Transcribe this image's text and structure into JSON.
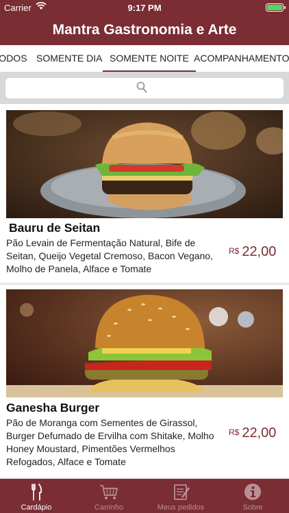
{
  "status_bar": {
    "carrier": "Carrier",
    "time": "9:17 PM"
  },
  "header": {
    "title": "Mantra Gastronomia e Arte"
  },
  "tabs": [
    {
      "label": "TODOS"
    },
    {
      "label": "SOMENTE DIA"
    },
    {
      "label": "SOMENTE NOITE",
      "active": true
    },
    {
      "label": "ACOMPANHAMENTOS"
    }
  ],
  "search": {
    "placeholder": ""
  },
  "menu_items": [
    {
      "name": "Bauru de Seitan",
      "description": "Pão Levain de Fermentação Natural, Bife de Seitan, Queijo Vegetal Cremoso, Bacon Vegano, Molho de Panela, Alface e Tomate",
      "currency": "R$",
      "price": "22,00"
    },
    {
      "name": "Ganesha Burger",
      "description": "Pão de Moranga com Sementes de Girassol, Burger Defumado de Ervilha com Shitake, Molho Honey Moustard, Pimentões Vermelhos Refogados, Alface e Tomate",
      "currency": "R$",
      "price": "22,00"
    }
  ],
  "tab_bar": [
    {
      "label": "Cardápio",
      "icon": "cutlery-icon",
      "active": true
    },
    {
      "label": "Carrinho",
      "icon": "cart-icon"
    },
    {
      "label": "Meus pedidos",
      "icon": "orders-icon"
    },
    {
      "label": "Sobre",
      "icon": "info-icon"
    }
  ],
  "colors": {
    "brand": "#7a2d33",
    "accent_text": "#7a2d33",
    "background": "#ebebeb"
  }
}
